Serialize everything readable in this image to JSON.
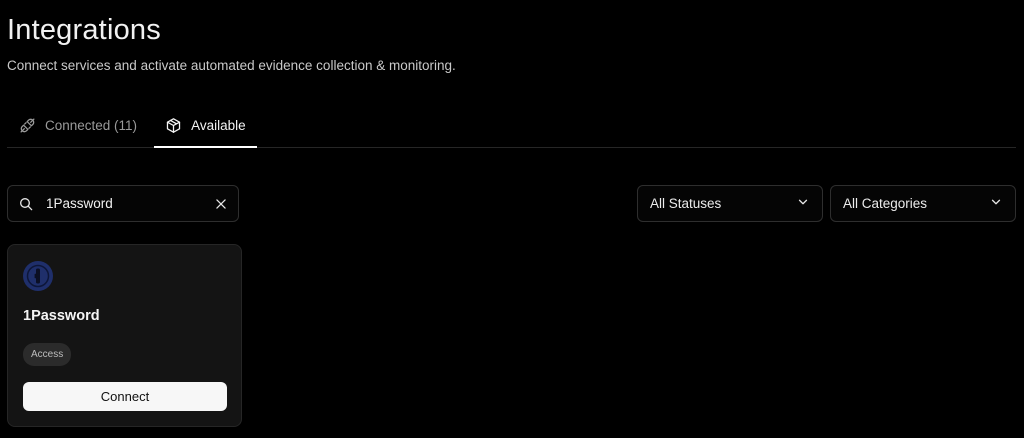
{
  "header": {
    "title": "Integrations",
    "subtitle": "Connect services and activate automated evidence collection & monitoring."
  },
  "tabs": [
    {
      "label": "Connected (11)",
      "icon": "plug-icon",
      "active": false
    },
    {
      "label": "Available",
      "icon": "package-icon",
      "active": true
    }
  ],
  "search": {
    "value": "1Password",
    "placeholder": "Search"
  },
  "filters": {
    "status": "All Statuses",
    "category": "All Categories"
  },
  "results": [
    {
      "name": "1Password",
      "logo": "1password-logo-icon",
      "category": "Access",
      "action_label": "Connect"
    }
  ],
  "colors": {
    "background": "#000000",
    "card": "#141414",
    "border": "#2e2e2e",
    "logo": "#1f2f6b",
    "button": "#f7f7f7"
  }
}
